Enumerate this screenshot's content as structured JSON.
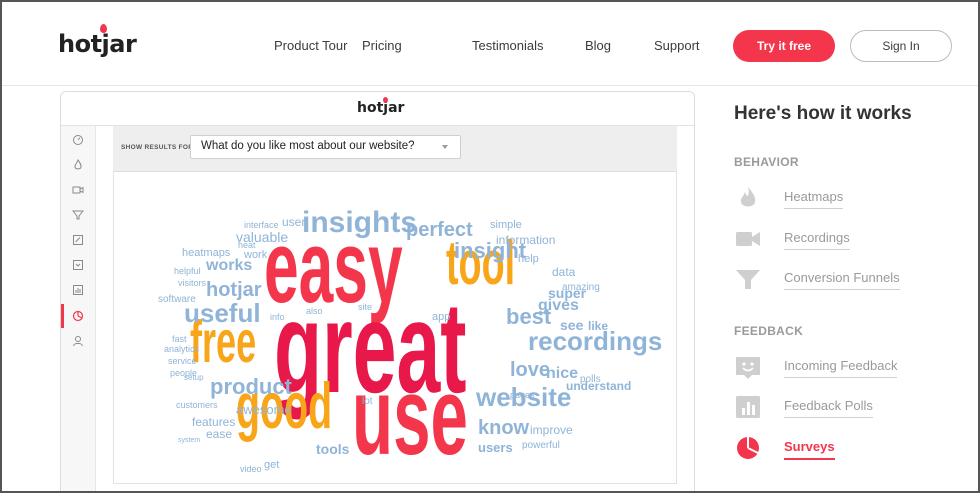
{
  "header": {
    "logo": "hotjar",
    "nav": [
      "Product Tour",
      "Pricing",
      "Testimonials",
      "Blog",
      "Support"
    ],
    "try_label": "Try it free",
    "signin_label": "Sign In"
  },
  "mock": {
    "logo": "hotjar",
    "show_results_label": "SHOW RESULTS FOR:",
    "survey_question": "What do you like most about our website?",
    "sidebar_icons": [
      "dashboard-icon",
      "heatmaps-icon",
      "recordings-icon",
      "funnels-icon",
      "forms-icon",
      "feedback-icon",
      "polls-icon",
      "surveys-icon",
      "user-icon"
    ],
    "word_cloud": [
      {
        "t": "easy",
        "c": "#f4364c",
        "s": 76,
        "b": true
      },
      {
        "t": "great",
        "c": "#e8184a",
        "s": 96,
        "b": true
      },
      {
        "t": "use",
        "c": "#f4364c",
        "s": 82,
        "b": true
      },
      {
        "t": "good",
        "c": "#f9a51a",
        "s": 48,
        "b": true
      },
      {
        "t": "free",
        "c": "#f9a51a",
        "s": 44,
        "b": true
      },
      {
        "t": "tool",
        "c": "#f9a51a",
        "s": 46,
        "b": true
      },
      {
        "t": "insights",
        "c": "#8fb4d8",
        "s": 30,
        "b": true
      },
      {
        "t": "recordings",
        "c": "#8fb4d8",
        "s": 26,
        "b": true
      },
      {
        "t": "website",
        "c": "#8fb4d8",
        "s": 26,
        "b": true
      },
      {
        "t": "useful",
        "c": "#8fb4d8",
        "s": 26,
        "b": true
      },
      {
        "t": "product",
        "c": "#8fb4d8",
        "s": 22,
        "b": true
      },
      {
        "t": "insight",
        "c": "#8fb4d8",
        "s": 22,
        "b": true
      },
      {
        "t": "best",
        "c": "#8fb4d8",
        "s": 22,
        "b": true
      },
      {
        "t": "love",
        "c": "#8fb4d8",
        "s": 20,
        "b": true
      },
      {
        "t": "know",
        "c": "#8fb4d8",
        "s": 20,
        "b": true
      },
      {
        "t": "perfect",
        "c": "#8fb4d8",
        "s": 20,
        "b": true
      },
      {
        "t": "hotjar",
        "c": "#8fb4d8",
        "s": 20,
        "b": true
      },
      {
        "t": "works",
        "c": "#8fb4d8",
        "s": 16,
        "b": true
      },
      {
        "t": "gives",
        "c": "#8fb4d8",
        "s": 16,
        "b": true
      },
      {
        "t": "nice",
        "c": "#8fb4d8",
        "s": 16,
        "b": true
      },
      {
        "t": "tools",
        "c": "#8fb4d8",
        "s": 14,
        "b": true
      },
      {
        "t": "valuable",
        "c": "#8fb4d8",
        "s": 14,
        "b": false
      },
      {
        "t": "super",
        "c": "#8fb4d8",
        "s": 14,
        "b": true
      },
      {
        "t": "awesome",
        "c": "#8fb4d8",
        "s": 13,
        "b": false
      },
      {
        "t": "features",
        "c": "#8fb4d8",
        "s": 12,
        "b": false
      },
      {
        "t": "understand",
        "c": "#8fb4d8",
        "s": 12,
        "b": true
      },
      {
        "t": "users",
        "c": "#8fb4d8",
        "s": 13,
        "b": true
      },
      {
        "t": "improve",
        "c": "#8fb4d8",
        "s": 12,
        "b": false
      },
      {
        "t": "information",
        "c": "#8fb4d8",
        "s": 12,
        "b": false
      },
      {
        "t": "ease",
        "c": "#8fb4d8",
        "s": 12,
        "b": false
      },
      {
        "t": "simple",
        "c": "#8fb4d8",
        "s": 11,
        "b": false
      },
      {
        "t": "heatmaps",
        "c": "#8fb4d8",
        "s": 11,
        "b": false
      },
      {
        "t": "work",
        "c": "#8fb4d8",
        "s": 11,
        "b": false
      },
      {
        "t": "software",
        "c": "#8fb4d8",
        "s": 10,
        "b": false
      },
      {
        "t": "see",
        "c": "#8fb4d8",
        "s": 14,
        "b": true
      },
      {
        "t": "like",
        "c": "#8fb4d8",
        "s": 12,
        "b": true
      },
      {
        "t": "help",
        "c": "#8fb4d8",
        "s": 11,
        "b": false
      },
      {
        "t": "data",
        "c": "#8fb4d8",
        "s": 12,
        "b": false
      },
      {
        "t": "pages",
        "c": "#8fb4d8",
        "s": 9,
        "b": false
      },
      {
        "t": "powerful",
        "c": "#8fb4d8",
        "s": 10,
        "b": false
      },
      {
        "t": "amazing",
        "c": "#8fb4d8",
        "s": 10,
        "b": false
      },
      {
        "t": "polls",
        "c": "#8fb4d8",
        "s": 10,
        "b": false
      },
      {
        "t": "user",
        "c": "#8fb4d8",
        "s": 12,
        "b": false
      },
      {
        "t": "interface",
        "c": "#8fb4d8",
        "s": 9,
        "b": false
      },
      {
        "t": "get",
        "c": "#8fb4d8",
        "s": 11,
        "b": false
      },
      {
        "t": "video",
        "c": "#8fb4d8",
        "s": 9,
        "b": false
      },
      {
        "t": "customers",
        "c": "#8fb4d8",
        "s": 9,
        "b": false
      },
      {
        "t": "people",
        "c": "#8fb4d8",
        "s": 9,
        "b": false
      },
      {
        "t": "service",
        "c": "#8fb4d8",
        "s": 9,
        "b": false
      },
      {
        "t": "fast",
        "c": "#8fb4d8",
        "s": 9,
        "b": false
      },
      {
        "t": "analytics",
        "c": "#8fb4d8",
        "s": 9,
        "b": false
      },
      {
        "t": "visitors",
        "c": "#8fb4d8",
        "s": 9,
        "b": false
      },
      {
        "t": "helpful",
        "c": "#8fb4d8",
        "s": 9,
        "b": false
      },
      {
        "t": "heat",
        "c": "#8fb4d8",
        "s": 9,
        "b": false
      },
      {
        "t": "app",
        "c": "#8fb4d8",
        "s": 11,
        "b": false
      },
      {
        "t": "also",
        "c": "#8fb4d8",
        "s": 9,
        "b": false
      },
      {
        "t": "site",
        "c": "#8fb4d8",
        "s": 9,
        "b": false
      },
      {
        "t": "lot",
        "c": "#8fb4d8",
        "s": 10,
        "b": false
      },
      {
        "t": "info",
        "c": "#8fb4d8",
        "s": 9,
        "b": false
      },
      {
        "t": "setup",
        "c": "#8fb4d8",
        "s": 8,
        "b": false
      },
      {
        "t": "system",
        "c": "#8fb4d8",
        "s": 7,
        "b": false
      }
    ]
  },
  "right": {
    "title": "Here's how it works",
    "behavior_label": "BEHAVIOR",
    "feedback_label": "FEEDBACK",
    "behavior_items": [
      {
        "label": "Heatmaps",
        "icon": "flame-icon"
      },
      {
        "label": "Recordings",
        "icon": "camera-icon"
      },
      {
        "label": "Conversion Funnels",
        "icon": "funnel-icon"
      }
    ],
    "feedback_items": [
      {
        "label": "Incoming Feedback",
        "icon": "smiley-icon"
      },
      {
        "label": "Feedback Polls",
        "icon": "poll-icon"
      },
      {
        "label": "Surveys",
        "icon": "pie-icon",
        "active": true
      }
    ],
    "accent": "#f4364c"
  }
}
